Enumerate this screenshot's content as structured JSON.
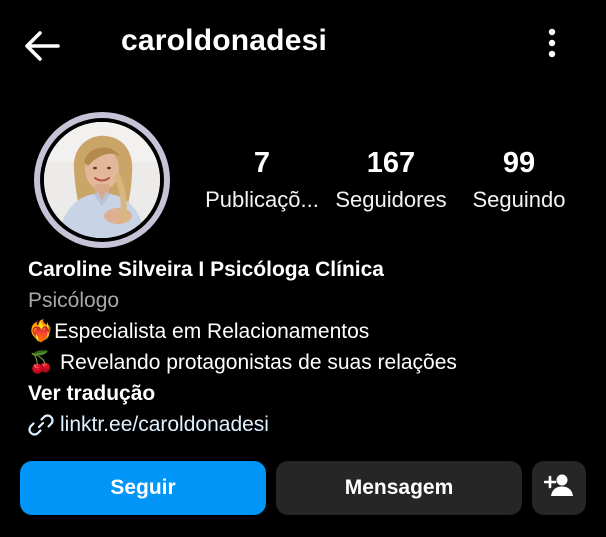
{
  "header": {
    "back_icon": "arrow-left-icon",
    "username": "caroldonadesi",
    "more_icon": "more-vertical-icon"
  },
  "profile": {
    "avatar_icon": "profile-photo",
    "ring_color": "#c7c2d6"
  },
  "stats": {
    "posts": {
      "value": "7",
      "label": "Publicaçõ..."
    },
    "followers": {
      "value": "167",
      "label": "Seguidores"
    },
    "following": {
      "value": "99",
      "label": "Seguindo"
    }
  },
  "bio": {
    "name": "Caroline Silveira I Psicóloga Clínica",
    "category": "Psicólogo",
    "line1": "❤️‍🔥Especialista em Relacionamentos",
    "line2": "🍒 Revelando protagonistas de suas relações",
    "translate": "Ver tradução",
    "link_icon": "link-icon",
    "link": "linktr.ee/caroldonadesi"
  },
  "actions": {
    "follow": "Seguir",
    "message": "Mensagem",
    "suggest_icon": "add-person-icon"
  },
  "colors": {
    "background": "#000000",
    "primary_button": "#0095f6",
    "secondary_button": "#262626",
    "muted_text": "#a8a8a8"
  }
}
